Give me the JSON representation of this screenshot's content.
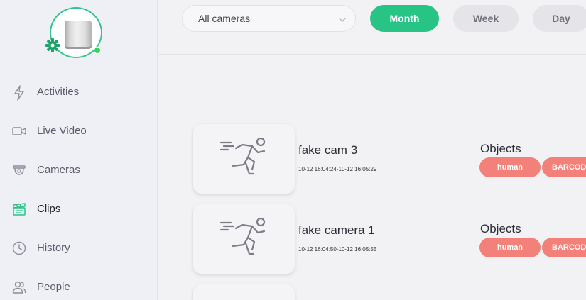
{
  "sidebar": {
    "device": {
      "status": "online",
      "accent_color": "#35c58c",
      "status_color": "#36d35a"
    },
    "items": [
      {
        "label": "Activities",
        "icon": "lightning-icon"
      },
      {
        "label": "Live Video",
        "icon": "video-icon"
      },
      {
        "label": "Cameras",
        "icon": "camera-icon"
      },
      {
        "label": "Clips",
        "icon": "clapperboard-icon",
        "active": true
      },
      {
        "label": "History",
        "icon": "clock-icon"
      },
      {
        "label": "People",
        "icon": "people-icon"
      }
    ]
  },
  "filters": {
    "camera_select": "All cameras",
    "ranges": [
      "Month",
      "Week",
      "Day"
    ],
    "active_range": "Month"
  },
  "clips": [
    {
      "camera": "fake cam 3",
      "time": "10-12 16:04:24-10-12 16:05:29",
      "objects_title": "Objects",
      "tags": [
        "human",
        "BARCODE"
      ]
    },
    {
      "camera": "fake camera 1",
      "time": "10-12 16:04:50-10-12 16:05:55",
      "objects_title": "Objects",
      "tags": [
        "human",
        "BARCODE"
      ]
    }
  ],
  "colors": {
    "accent": "#27c485",
    "tag": "#f4807a"
  }
}
